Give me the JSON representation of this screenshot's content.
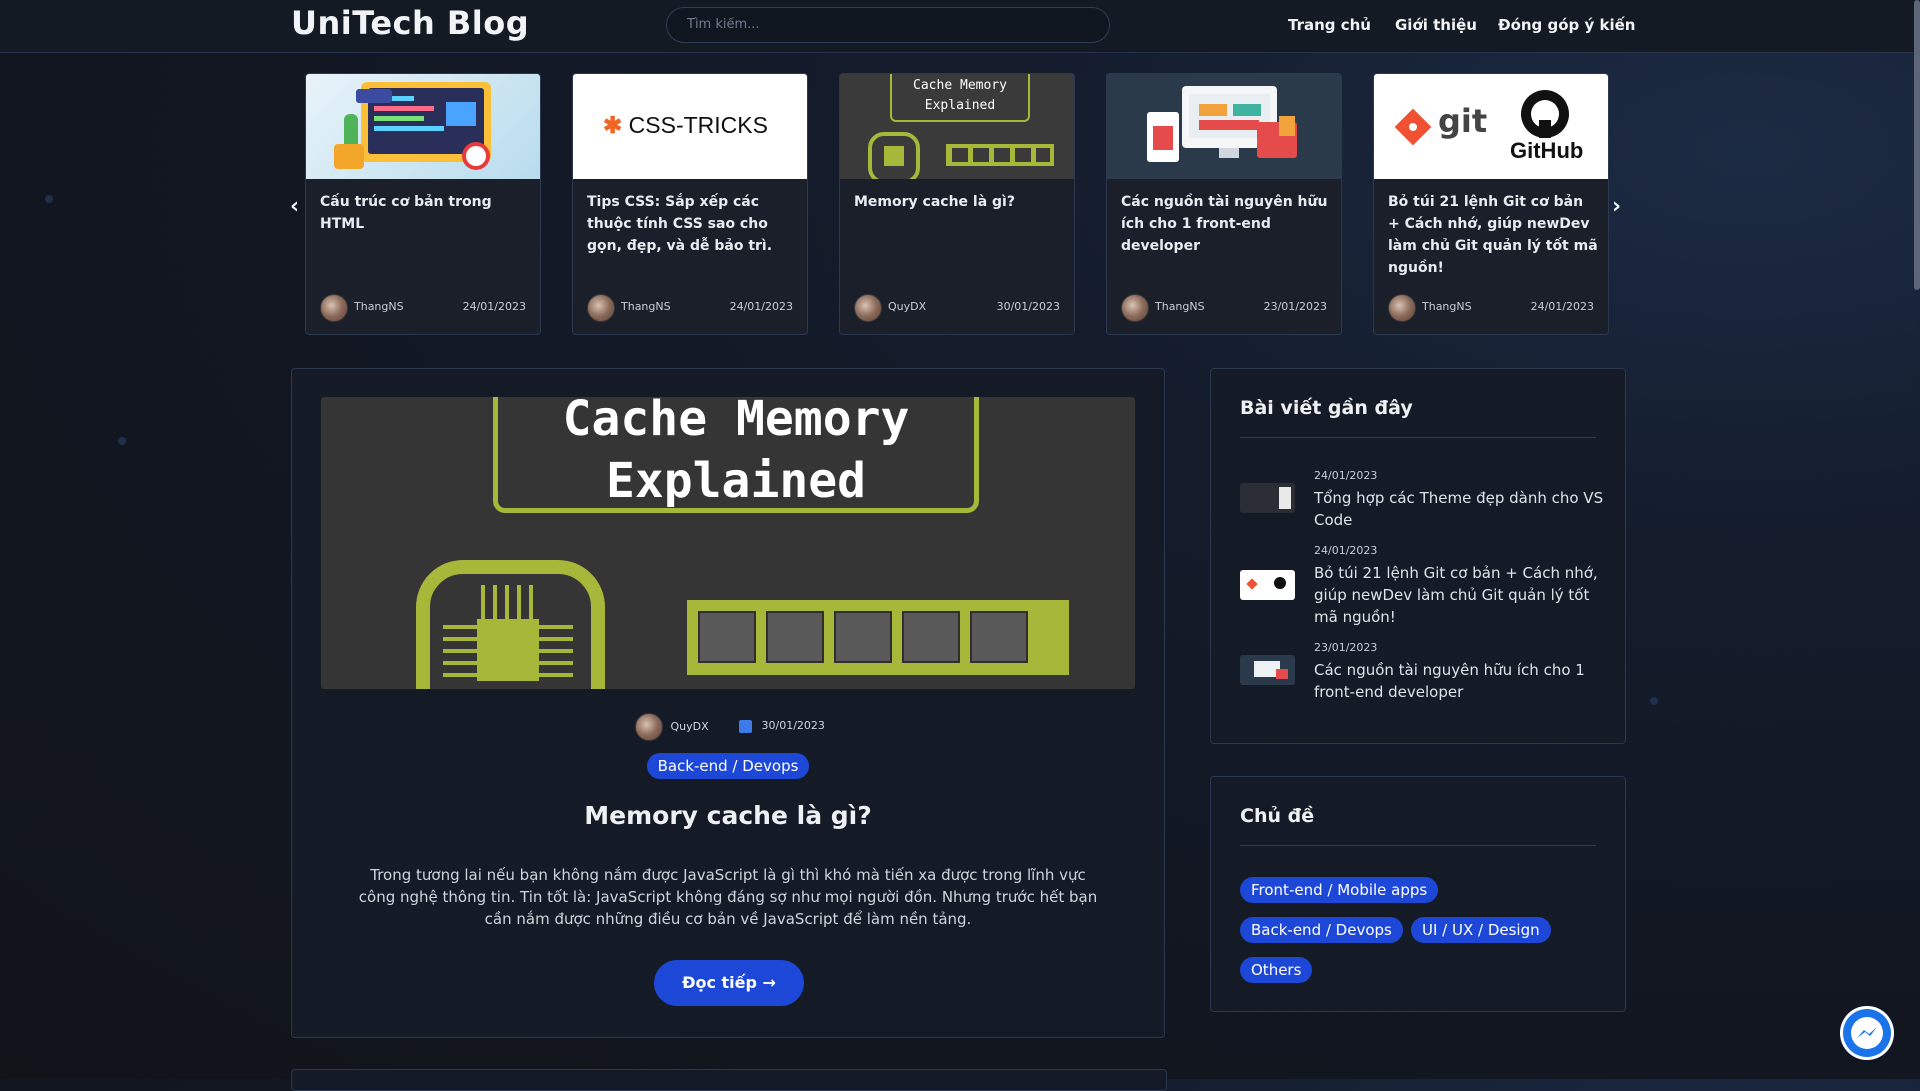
{
  "header": {
    "logo": "UniTech Blog",
    "search_placeholder": "Tìm kiếm...",
    "nav": [
      "Trang chủ",
      "Giới thiệu",
      "Đóng góp ý kiến"
    ]
  },
  "carousel": {
    "cards": [
      {
        "title": "Cấu trúc cơ bản trong HTML",
        "author": "ThangNS",
        "date": "24/01/2023",
        "thumb": "html-illustration"
      },
      {
        "title": "Tips CSS: Sắp xếp các thuộc tính CSS sao cho gọn, đẹp, và dễ bảo trì.",
        "author": "ThangNS",
        "date": "24/01/2023",
        "thumb": "css-tricks-logo",
        "thumb_text": "CSS-TRICKS"
      },
      {
        "title": "Memory cache là gì?",
        "author": "QuyDX",
        "date": "30/01/2023",
        "thumb": "cache-memory",
        "thumb_text": "Cache Memory Explained"
      },
      {
        "title": "Các nguồn tài nguyên hữu ích cho 1 front-end developer",
        "author": "ThangNS",
        "date": "23/01/2023",
        "thumb": "frontend-devices"
      },
      {
        "title": "Bỏ túi 21 lệnh Git cơ bản + Cách nhớ, giúp newDev làm chủ Git quản lý tốt mã nguồn!",
        "author": "ThangNS",
        "date": "24/01/2023",
        "thumb": "git-github",
        "thumb_git": "git",
        "thumb_github": "GitHub"
      }
    ]
  },
  "featured": {
    "hero_text": [
      "Cache Memory",
      "Explained"
    ],
    "author": "QuyDX",
    "date": "30/01/2023",
    "category": "Back-end / Devops",
    "title": "Memory cache là gì?",
    "excerpt": "Trong tương lai nếu bạn không nắm được JavaScript là gì thì khó mà tiến xa được trong lĩnh vực công nghệ thông tin. Tin tốt là: JavaScript không đáng sợ như mọi người đồn. Nhưng trước hết bạn cần nắm được những điều cơ bản về JavaScript để làm nền tảng.",
    "read_more": "Đọc tiếp →"
  },
  "sidebar": {
    "recent_title": "Bài viết gần đây",
    "recent": [
      {
        "date": "24/01/2023",
        "title": "Tổng hợp các Theme đẹp dành cho VS Code"
      },
      {
        "date": "24/01/2023",
        "title": "Bỏ túi 21 lệnh Git cơ bản + Cách nhớ, giúp newDev làm chủ Git quản lý tốt mã nguồn!"
      },
      {
        "date": "23/01/2023",
        "title": "Các nguồn tài nguyên hữu ích cho 1 front-end developer"
      }
    ],
    "topics_title": "Chủ đề",
    "topics": [
      "Front-end / Mobile apps",
      "Back-end / Devops",
      "UI / UX / Design",
      "Others"
    ]
  },
  "colors": {
    "accent": "#1d47d6",
    "cache_green": "#a5b83a"
  }
}
